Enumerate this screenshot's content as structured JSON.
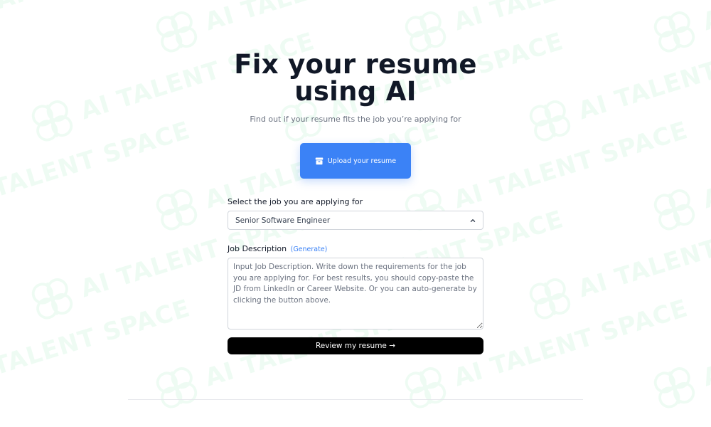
{
  "watermark": {
    "text": "AI TALENT SPACE",
    "icon": "brain-icon",
    "color": "#4ade80"
  },
  "hero": {
    "title_line1": "Fix your resume",
    "title_line2": "using AI",
    "subtitle": "Find out if your resume fits the job you’re applying for"
  },
  "upload": {
    "label": "Upload your resume",
    "icon": "archive-box-icon",
    "color": "#3b82f6"
  },
  "job_select": {
    "label": "Select the job you are applying for",
    "selected_value": "Senior Software Engineer",
    "icon": "chevron-up-icon"
  },
  "job_description": {
    "label": "Job Description",
    "generate_link": "(Generate)",
    "value": "",
    "placeholder": "Input Job Description. Write down the requirements for the job you are applying for. For best results, you should copy-paste the JD from LinkedIn or Career Website. Or you can auto-generate by clicking the button above."
  },
  "review": {
    "label": "Review my resume →"
  }
}
